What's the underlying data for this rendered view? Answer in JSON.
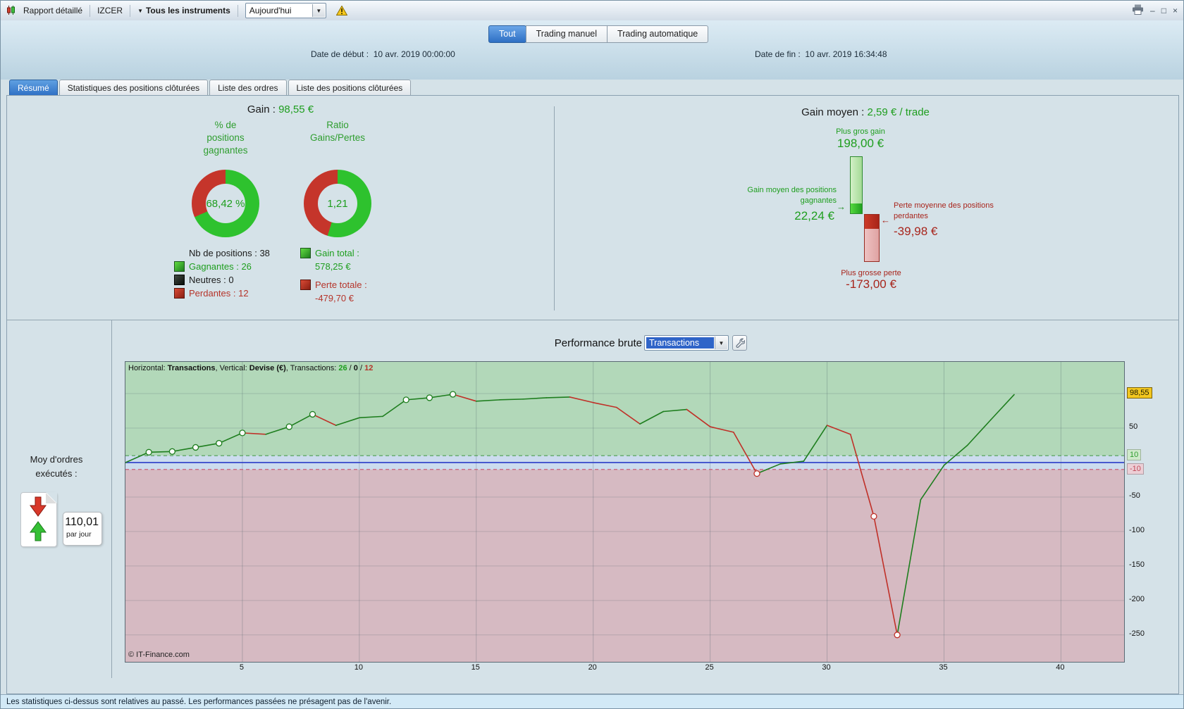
{
  "palette": {
    "green": "#2ec22e",
    "red": "#c5352b",
    "accent_blue": "#2e6fc4"
  },
  "titlebar": {
    "report_button": "Rapport détaillé",
    "account_button": "IZCER",
    "instruments_button": "Tous les instruments",
    "period_select": "Aujourd'hui"
  },
  "window_controls": {
    "minimize": "–",
    "maximize": "□",
    "close": "×"
  },
  "header": {
    "mode_tabs": [
      {
        "label": "Tout"
      },
      {
        "label": "Trading manuel"
      },
      {
        "label": "Trading automatique"
      }
    ],
    "date_start_label": "Date de début :",
    "date_start_value": "10 avr. 2019 00:00:00",
    "date_end_label": "Date de fin :",
    "date_end_value": "10 avr. 2019 16:34:48"
  },
  "tabs": [
    {
      "label": "Résumé"
    },
    {
      "label": "Statistiques des positions clôturées"
    },
    {
      "label": "Liste des ordres"
    },
    {
      "label": "Liste des positions clôturées"
    }
  ],
  "summary": {
    "gain_label": "Gain :",
    "gain_value": "98,55 €",
    "donuts": [
      {
        "title_lines": [
          "% de",
          "positions",
          "gagnantes"
        ],
        "value": "68,42 %",
        "green_pct": 68.42
      },
      {
        "title_lines": [
          "Ratio",
          "Gains/Pertes"
        ],
        "value": "1,21",
        "green_pct": 54.8
      }
    ],
    "positions_label": "Nb de positions : 38",
    "legend": [
      {
        "label": "Gagnantes : 26"
      },
      {
        "label": "Neutres : 0"
      },
      {
        "label": "Perdantes : 12"
      }
    ],
    "gain_total_label": "Gain total :",
    "gain_total_value": "578,25 €",
    "loss_total_label": "Perte totale :",
    "loss_total_value": "-479,70 €"
  },
  "average": {
    "title_label": "Gain moyen :",
    "title_value": "2,59 € / trade",
    "biggest_gain_label": "Plus gros gain",
    "biggest_gain_value": "198,00 €",
    "avg_win_label_lines": [
      "Gain moyen des positions",
      "gagnantes"
    ],
    "avg_win_value": "22,24 €",
    "avg_win_arrow": "→",
    "avg_loss_label_lines": [
      "Perte moyenne des positions",
      "perdantes"
    ],
    "avg_loss_value": "-39,98 €",
    "avg_loss_arrow": "←",
    "biggest_loss_label": "Plus grosse perte",
    "biggest_loss_value": "-173,00 €"
  },
  "chart_section": {
    "title": "Performance brute",
    "select_value": "Transactions",
    "orders_label_lines": [
      "Moy d'ordres",
      "exécutés :"
    ],
    "orders_value": "110,01",
    "orders_unit": "par jour"
  },
  "chart_data": {
    "type": "line",
    "title": "Performance brute",
    "xlabel": "Transactions",
    "ylabel": "Devise (€)",
    "header": {
      "h_label": "Horizontal: ",
      "h_value": "Transactions",
      "v_label": ", Vertical: ",
      "v_value": "Devise (€)",
      "t_label": ", Transactions: ",
      "wins": "26",
      "sep1": " / ",
      "neutral": "0",
      "sep2": " / ",
      "losses": "12"
    },
    "start_value": 0,
    "values": [
      15,
      16,
      22,
      28,
      43,
      41,
      52,
      70,
      54,
      65,
      67,
      91,
      94,
      99,
      89,
      91,
      92,
      94,
      95,
      87,
      80,
      56,
      74,
      77,
      52,
      44,
      -16,
      -2,
      2,
      54,
      41,
      -78,
      -250,
      -54,
      -4,
      25,
      62,
      98.55
    ],
    "markers": [
      1,
      2,
      3,
      4,
      5,
      7,
      8,
      12,
      13,
      14,
      27,
      32,
      33
    ],
    "x_ticks": [
      5,
      10,
      15,
      20,
      25,
      30,
      35,
      40
    ],
    "y_tick_labels": [
      {
        "v": 50,
        "label": "50"
      },
      {
        "v": -50,
        "label": "-50"
      },
      {
        "v": -100,
        "label": "-100"
      },
      {
        "v": -150,
        "label": "-150"
      },
      {
        "v": -200,
        "label": "-200"
      },
      {
        "v": -250,
        "label": "-250"
      }
    ],
    "grid_y": [
      100,
      50,
      -50,
      -100,
      -150,
      -200,
      -250
    ],
    "badges": {
      "current": {
        "label": "98,55",
        "v": 98.55
      },
      "upper": {
        "label": "10",
        "v": 10
      },
      "lower": {
        "label": "-10",
        "v": -10
      }
    },
    "band": 10,
    "xlim": [
      0,
      42.7
    ],
    "ylim": [
      -289,
      146
    ],
    "copyright": "© IT-Finance.com",
    "colors": {
      "up": "#1e7e1e",
      "down": "#c03028",
      "zone_pos": "#b2d8b9",
      "zone_neg": "#d6bac2",
      "zone_band": "#ccdcee",
      "zero_line": "#2a3cc8",
      "upper_dash": "#4e9e54",
      "lower_dash": "#cc5e78"
    }
  },
  "statusbar": {
    "text": "Les statistiques ci-dessus sont relatives au passé. Les performances passées ne présagent pas de l'avenir."
  }
}
